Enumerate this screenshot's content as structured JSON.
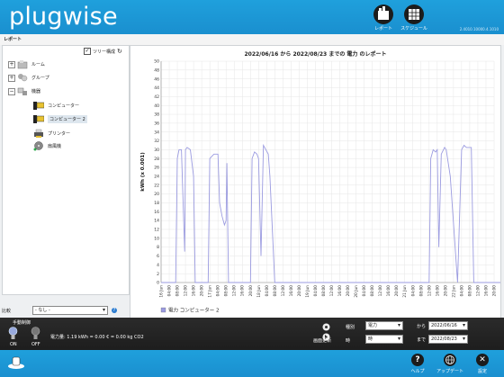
{
  "app": {
    "logo": "plugwise",
    "version": "2.4010.10000.4.1010"
  },
  "header": {
    "report_label": "レポート",
    "schedule_label": "スケジュール"
  },
  "toolbar": {
    "title": "レポート"
  },
  "tree": {
    "tree_display_label": "ツリー構成",
    "tree_display_checked": "✓",
    "nodes": [
      {
        "label": "ルーム",
        "icon": "room-icon"
      },
      {
        "label": "グループ",
        "icon": "group-icon"
      },
      {
        "label": "機器",
        "icon": "devices-icon"
      },
      {
        "label": "コンピューター",
        "icon": "computer-icon"
      },
      {
        "label": "コンピューター 2",
        "icon": "computer-icon"
      },
      {
        "label": "プリンター",
        "icon": "printer-icon"
      },
      {
        "label": "扇風機",
        "icon": "fan-icon"
      }
    ]
  },
  "filter": {
    "label": "比較",
    "value": "- なし -"
  },
  "chart_data": {
    "type": "line",
    "title": "2022/06/16 から 2022/08/23 までの 電力 のレポート",
    "ylabel": "kWh (x 0.001)",
    "ylim": [
      0,
      50
    ],
    "yticks": [
      0,
      2,
      4,
      6,
      8,
      10,
      12,
      14,
      16,
      18,
      20,
      22,
      24,
      26,
      28,
      30,
      32,
      34,
      36,
      38,
      40,
      42,
      44,
      46,
      48,
      50
    ],
    "x_tick_labels": [
      "16 Jun",
      "04:00",
      "08:00",
      "12:00",
      "16:00",
      "20:00",
      "17 Jun",
      "04:00",
      "08:00",
      "12:00",
      "16:00",
      "20:00",
      "18 Jun",
      "04:00",
      "08:00",
      "12:00",
      "16:00",
      "20:00",
      "19 Jun",
      "04:00",
      "08:00",
      "12:00",
      "16:00",
      "20:00",
      "20 Jun",
      "04:00",
      "08:00",
      "12:00",
      "16:00",
      "20:00",
      "21 Jun",
      "04:00",
      "08:00",
      "12:00",
      "16:00",
      "20:00",
      "22 Jun",
      "04:00",
      "08:00",
      "12:00",
      "16:00",
      "20:00"
    ],
    "series": [
      {
        "name": "電力 コンピューター 2",
        "color": "#9b9be0",
        "x": [
          0,
          1.8,
          2,
          2.2,
          2.5,
          2.9,
          3,
          3.2,
          3.6,
          4,
          4.2,
          4.5,
          5.8,
          6,
          6.5,
          7,
          7.2,
          7.4,
          7.5,
          7.8,
          8,
          8.1,
          8.3,
          8.4,
          8.5,
          8.6,
          11,
          11.2,
          11.5,
          11.8,
          12,
          12.3,
          12.6,
          13.2,
          13.4,
          14,
          15,
          20,
          26,
          32,
          33,
          33.2,
          33.5,
          33.8,
          34,
          34.2,
          34.5,
          34.9,
          35.1,
          35.6,
          36.5,
          37,
          37.3,
          37.6,
          38.2,
          38.5,
          40,
          42
        ],
        "y": [
          0,
          0,
          28,
          30,
          30,
          7,
          30,
          30.5,
          30,
          24,
          0,
          0,
          0,
          28,
          29,
          29,
          18,
          16,
          15,
          13,
          14,
          27,
          0,
          0,
          0,
          0,
          0,
          28,
          29.5,
          29,
          28,
          6,
          31,
          29,
          24,
          0,
          0,
          0,
          0,
          0,
          0,
          28,
          30,
          29.5,
          30,
          8,
          29,
          30.5,
          30,
          24,
          0,
          30,
          31,
          30.5,
          30.5,
          0,
          0,
          0
        ]
      }
    ],
    "legend": [
      "電力 コンピューター 2"
    ],
    "legend_position": "bottom-left"
  },
  "bottom": {
    "manual_label": "手動制御",
    "on_label": "ON",
    "off_label": "OFF",
    "power_text": "電力量: 1.19 kWh = 0.00 € = 0.00 kg CO2",
    "type_label": "種別",
    "type_value": "電力",
    "refresh_label": "画面更新",
    "unit_label": "時",
    "unit_value": "時",
    "from_label": "から",
    "from_value": "2022/06/16",
    "to_label": "まで",
    "to_value": "2022/08/23"
  },
  "statusbar": {
    "help": "ヘルプ",
    "update": "アップデート",
    "settings": "設定",
    "help_icon_char": "?",
    "settings_icon_char": "✕"
  }
}
